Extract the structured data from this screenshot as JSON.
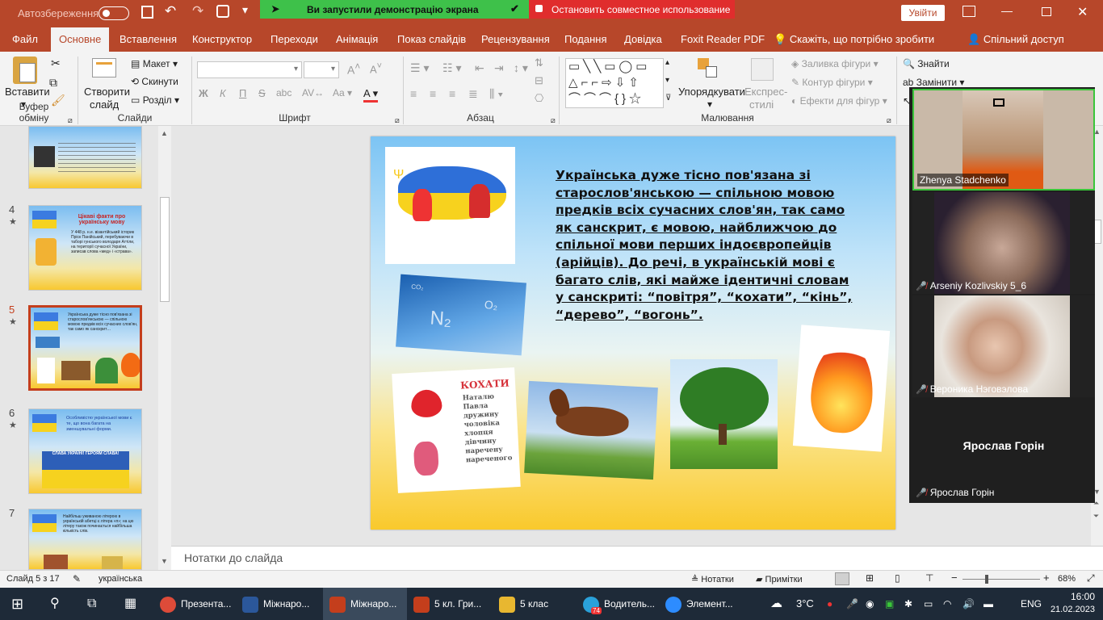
{
  "title_bar": {
    "autosave_label": "Автозбереження",
    "autosave_state": "off",
    "share_banner": "Ви запустили демонстрацію экрана",
    "stop_sharing": "Остановить совместное использование",
    "signin": "Увійти"
  },
  "tabs": [
    "Файл",
    "Основне",
    "Вставлення",
    "Конструктор",
    "Переходи",
    "Анімація",
    "Показ слайдів",
    "Рецензування",
    "Подання",
    "Довідка",
    "Foxit Reader PDF"
  ],
  "active_tab": "Основне",
  "tell_me": "Скажіть, що потрібно зробити",
  "share": "Спільний доступ",
  "ribbon": {
    "clipboard": {
      "paste": "Вставити",
      "group": "Буфер обміну"
    },
    "slides": {
      "new_slide": "Створити",
      "new_slide2": "слайд",
      "layout": "Макет",
      "reset": "Скинути",
      "section": "Розділ",
      "group": "Слайди"
    },
    "font": {
      "group": "Шрифт",
      "bold": "Ж",
      "italic": "К",
      "underline": "П",
      "strike": "S"
    },
    "paragraph": {
      "group": "Абзац"
    },
    "drawing": {
      "arrange": "Упорядкувати",
      "quick_styles": "Експрес-",
      "quick_styles2": "стилі",
      "fill": "Заливка фігури",
      "outline": "Контур фігури",
      "effects": "Ефекти для фігур",
      "group": "Малювання"
    },
    "editing": {
      "find": "Знайти",
      "replace": "Замінити"
    }
  },
  "thumbnails": [
    {
      "num": "4",
      "star": "★",
      "title": "Цікаві факти про українську мову",
      "text": "У 448 р. н.е. візантійський історик Пріск Панійський, перебуваючи в таборі гунського володаря Аттіли, на території сучасної України, записав слова «мед» і «страва»."
    },
    {
      "num": "5",
      "star": "★",
      "selected": true,
      "text": "Українська дуже тісно пов'язана зі старослов'янською — спільною мовою предків всіх сучасних слов'ян, так само як санскрит…"
    },
    {
      "num": "6",
      "star": "★",
      "text": "Особливістю української мови є те, що вона багата на зменшувальні форми.",
      "banner": "СЛАВА УКРАЇНІ! ГЕРОЯМ СЛАВА!"
    },
    {
      "num": "7",
      "star": "",
      "text": "Найбільш уживаною літерою в українській абетці є літера «п»; на цю літеру також починається найбільша кількість слів."
    }
  ],
  "slide": {
    "text": "Українська дуже тісно пов'язана зі старослов'янською — спільною мовою предків всіх сучасних слов'ян, так само як санскрит, є мовою, найближчою до спільної мови перших індоєвропейців (арійців). До речі, в українській мові є багато слів, які майже ідентичні словам у санскриті: “повітря”, “кохати”, “кінь”, “дерево”, “вогонь”.",
    "card_title": "КОХАТИ",
    "card_words": [
      "Наталю",
      "Павла",
      "дружину",
      "чоловіка",
      "хлопця",
      "дівчину",
      "наречену",
      "нареченого"
    ],
    "sky_labels": [
      "N₂",
      "O₂",
      "CO₂"
    ]
  },
  "notes_placeholder": "Нотатки до слайда",
  "status": {
    "slide_count": "Слайд 5 з 17",
    "language": "українська",
    "notes": "Нотатки",
    "comments": "Примітки",
    "zoom": "68%"
  },
  "zoom_participants": [
    {
      "name": "Zhenya Stadchenko",
      "muted": false
    },
    {
      "name": "Arseniy Kozlivskiy 5_6",
      "muted": true
    },
    {
      "name": "Вероника Нэговэлова",
      "muted": true
    },
    {
      "name": "Ярослав Горін",
      "muted": true,
      "no_video": true
    }
  ],
  "taskbar": {
    "apps": [
      {
        "label": "Презента...",
        "color": "#dd4b39"
      },
      {
        "label": "Міжнаро...",
        "color": "#2b579a"
      },
      {
        "label": "Міжнаро...",
        "color": "#c43e1c"
      },
      {
        "label": "5 кл. Гри...",
        "color": "#c43e1c"
      },
      {
        "label": "5 клас",
        "color": "#e8b730"
      },
      {
        "label": "Водитель...",
        "color": "#2aa1da"
      },
      {
        "label": "Элемент...",
        "color": "#2d8cff"
      }
    ],
    "weather": "3°C",
    "lang": "ENG",
    "time": "16:00",
    "date": "21.02.2023",
    "telegram_badge": "74"
  }
}
